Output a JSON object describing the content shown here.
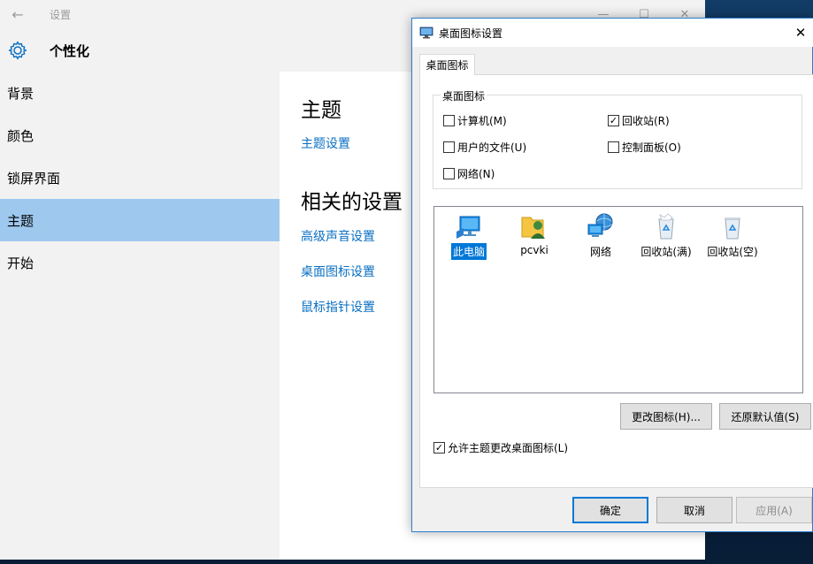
{
  "settings": {
    "window_title": "设置",
    "header_title": "个性化",
    "nav": [
      {
        "label": "背景"
      },
      {
        "label": "颜色"
      },
      {
        "label": "锁屏界面"
      },
      {
        "label": "主题"
      },
      {
        "label": "开始"
      }
    ],
    "main": {
      "heading": "主题",
      "theme_settings_link": "主题设置",
      "related_heading": "相关的设置",
      "links": [
        "高级声音设置",
        "桌面图标设置",
        "鼠标指针设置"
      ]
    }
  },
  "dialog": {
    "title": "桌面图标设置",
    "tab": "桌面图标",
    "group_label": "桌面图标",
    "checkboxes": [
      {
        "label": "计算机(M)",
        "checked": false
      },
      {
        "label": "回收站(R)",
        "checked": true
      },
      {
        "label": "用户的文件(U)",
        "checked": false
      },
      {
        "label": "控制面板(O)",
        "checked": false
      },
      {
        "label": "网络(N)",
        "checked": false
      }
    ],
    "icons": [
      {
        "label": "此电脑",
        "icon": "this-pc-icon",
        "selected": true
      },
      {
        "label": "pcvki",
        "icon": "user-folder-icon",
        "selected": false
      },
      {
        "label": "网络",
        "icon": "network-icon",
        "selected": false
      },
      {
        "label": "回收站(满)",
        "icon": "recycle-bin-full-icon",
        "selected": false
      },
      {
        "label": "回收站(空)",
        "icon": "recycle-bin-empty-icon",
        "selected": false
      }
    ],
    "change_icon_button": "更改图标(H)...",
    "restore_default_button": "还原默认值(S)",
    "allow_themes_checkbox": {
      "label": "允许主题更改桌面图标(L)",
      "checked": true
    },
    "ok_button": "确定",
    "cancel_button": "取消",
    "apply_button": "应用(A)"
  },
  "colors": {
    "accent": "#0078d7",
    "link": "#0a6fc2",
    "nav_selected": "#9ec8ee"
  }
}
